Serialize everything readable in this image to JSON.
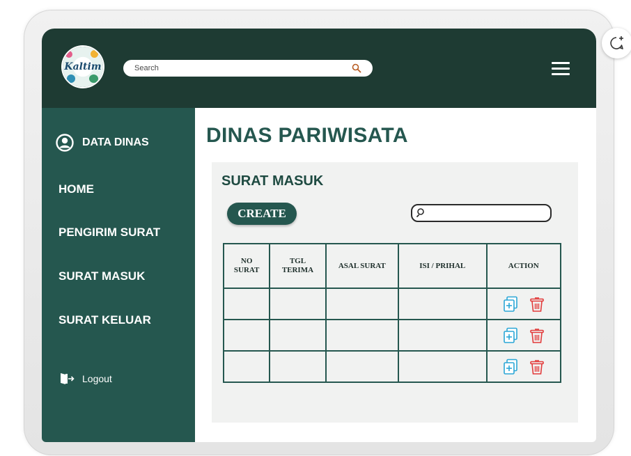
{
  "brand": {
    "logo_text": "Kaltim"
  },
  "header": {
    "search_placeholder": "Search"
  },
  "sidebar": {
    "profile_label": "DATA DINAS",
    "items": [
      {
        "label": "HOME"
      },
      {
        "label": "PENGIRIM SURAT"
      },
      {
        "label": "SURAT MASUK"
      },
      {
        "label": "SURAT KELUAR"
      }
    ],
    "logout_label": "Logout"
  },
  "main": {
    "title": "DINAS PARIWISATA"
  },
  "panel": {
    "title": "SURAT MASUK",
    "create_label": "CREATE",
    "table": {
      "headers": [
        {
          "line1": "NO",
          "line2": "SURAT"
        },
        {
          "line1": "TGL",
          "line2": "TERIMA"
        },
        {
          "line1": "ASAL SURAT",
          "line2": ""
        },
        {
          "line1": "ISI / PRIHAL",
          "line2": ""
        },
        {
          "line1": "ACTION",
          "line2": ""
        }
      ],
      "rows": [
        [
          "",
          "",
          "",
          ""
        ],
        [
          "",
          "",
          "",
          ""
        ],
        [
          "",
          "",
          "",
          ""
        ]
      ]
    }
  },
  "colors": {
    "topbar": "#1e3b33",
    "sidebar": "#25574f",
    "title": "#25574f",
    "add_icon": "#2aa6d6",
    "delete_icon": "#e23b3b"
  },
  "icons": {
    "search": "search-icon",
    "menu": "hamburger-menu-icon",
    "profile": "user-circle-icon",
    "logout": "logout-icon",
    "add": "add-copy-icon",
    "delete": "trash-icon",
    "fab": "chat-plus-icon"
  }
}
